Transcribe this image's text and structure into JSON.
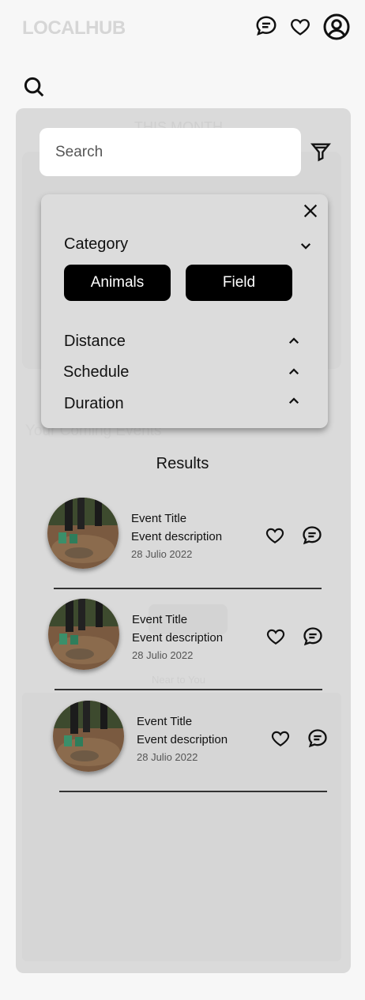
{
  "header": {
    "logo": "LOCALHUB",
    "icons": [
      "chat-icon",
      "heart-icon",
      "profile-icon"
    ]
  },
  "background": {
    "section_title": "THIS MONTH",
    "section_heading": "Your Coming Events",
    "near_label": "Near to You"
  },
  "search": {
    "placeholder": "Search"
  },
  "filter": {
    "category_label": "Category",
    "chips": [
      "Animals",
      "Field"
    ],
    "distance_label": "Distance",
    "schedule_label": "Schedule",
    "duration_label": "Duration"
  },
  "results": {
    "title": "Results",
    "items": [
      {
        "title": "Event Title",
        "description": "Event description",
        "date": "28 Julio 2022"
      },
      {
        "title": "Event Title",
        "description": "Event description",
        "date": "28 Julio 2022"
      },
      {
        "title": "Event Title",
        "description": "Event description",
        "date": "28 Julio 2022"
      }
    ]
  },
  "colors": {
    "accent": "#000000",
    "panel": "#dadada",
    "logo": "#d6d6d6"
  }
}
